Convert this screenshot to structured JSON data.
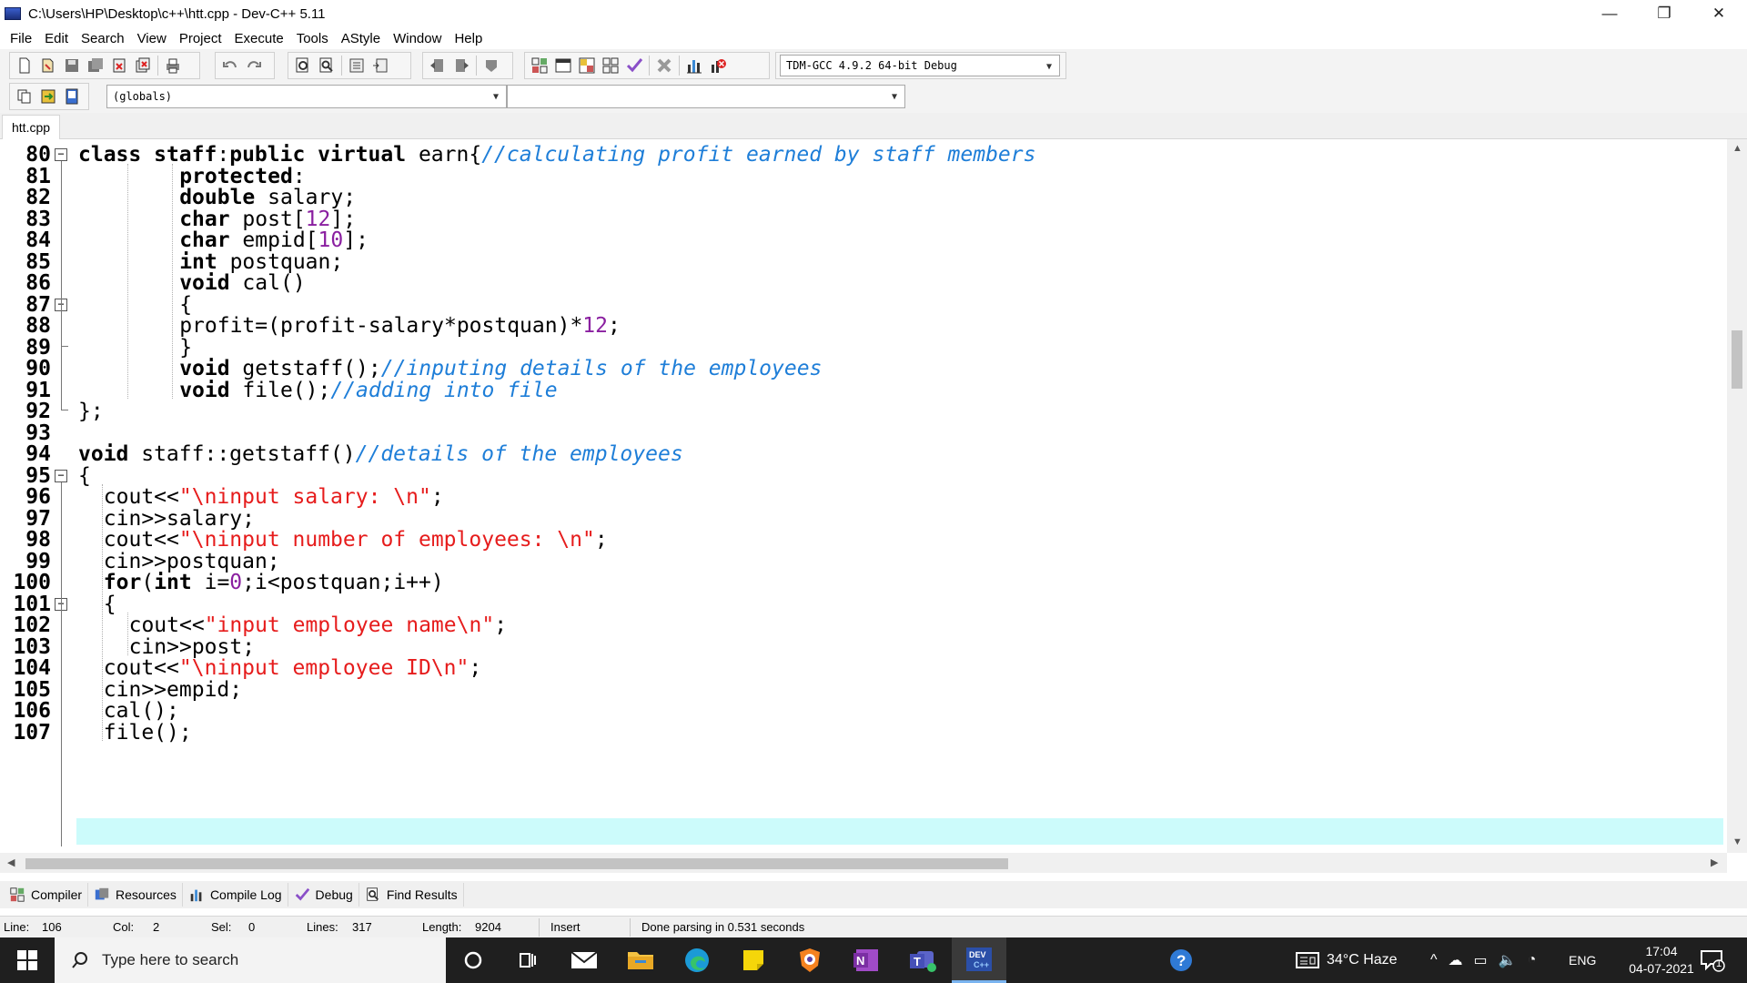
{
  "window": {
    "title": "C:\\Users\\HP\\Desktop\\c++\\htt.cpp - Dev-C++ 5.11",
    "minimize": "—",
    "maximize": "❐",
    "close": "✕"
  },
  "menu": [
    "File",
    "Edit",
    "Search",
    "View",
    "Project",
    "Execute",
    "Tools",
    "AStyle",
    "Window",
    "Help"
  ],
  "toolbar": {
    "compiler_select": "TDM-GCC 4.9.2 64-bit Debug",
    "scope_select": "(globals)",
    "member_select": ""
  },
  "tabs": [
    "htt.cpp"
  ],
  "editor": {
    "line_numbers": [
      "80",
      "81",
      "82",
      "83",
      "84",
      "85",
      "86",
      "87",
      "88",
      "89",
      "90",
      "91",
      "92",
      "93",
      "94",
      "95",
      "96",
      "97",
      "98",
      "99",
      "100",
      "101",
      "102",
      "103",
      "104",
      "105",
      "106",
      "107"
    ],
    "highlight_line": "106",
    "colors": {
      "comment": "#1e7ed8",
      "string": "#e61c1c",
      "number": "#8a1fa0",
      "current_line": "#ccfbfb"
    }
  },
  "bottom_tabs": [
    "Compiler",
    "Resources",
    "Compile Log",
    "Debug",
    "Find Results"
  ],
  "status": {
    "line_label": "Line:",
    "line_value": "106",
    "col_label": "Col:",
    "col_value": "2",
    "sel_label": "Sel:",
    "sel_value": "0",
    "lines_label": "Lines:",
    "lines_value": "317",
    "length_label": "Length:",
    "length_value": "9204",
    "mode": "Insert",
    "message": "Done parsing in 0.531 seconds"
  },
  "taskbar": {
    "search_placeholder": "Type here to search",
    "weather": "34°C  Haze",
    "language": "ENG",
    "time": "17:04",
    "date": "04-07-2021",
    "notification_count": "1"
  }
}
